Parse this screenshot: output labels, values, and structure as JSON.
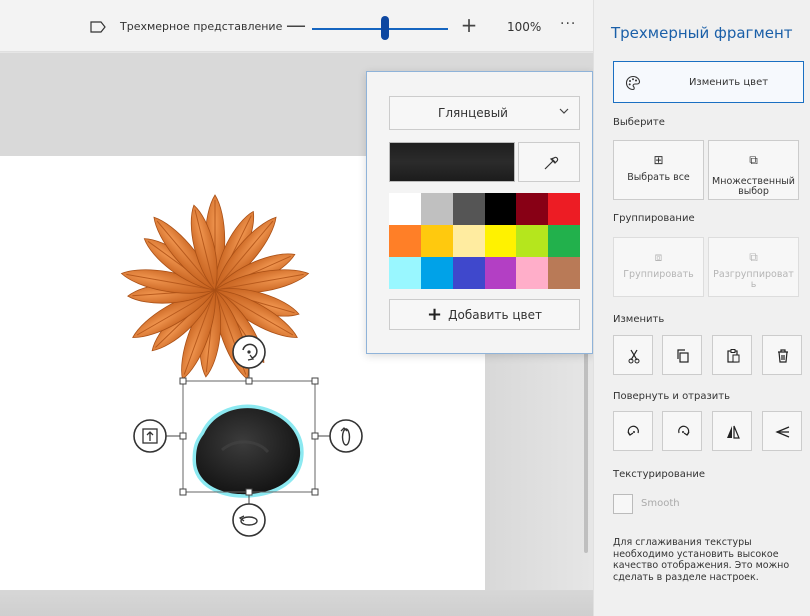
{
  "toolbar": {
    "view_icon": "view-3d-icon",
    "view_label": "Трехмерное представление",
    "zoom_minus": "—",
    "zoom_plus": "+",
    "zoom_level": "100%",
    "zoom_slider_value": 0.5,
    "more": "···"
  },
  "canvas": {
    "objects": [
      "flower-object",
      "stone-object"
    ],
    "gizmo_icons": [
      "rotate-z-icon",
      "rotate-y-icon",
      "move-depth-icon",
      "rotate-x-icon"
    ]
  },
  "color_popup": {
    "material": "Глянцевый",
    "current_color": "#222222",
    "eyedropper_icon": "eyedropper-icon",
    "swatches": [
      "#ffffff",
      "#c0c0c0",
      "#555555",
      "#000000",
      "#880015",
      "#ed1c24",
      "#ff7f27",
      "#ffc90e",
      "#ffeca0",
      "#fff200",
      "#b5e61d",
      "#22b14c",
      "#99f7ff",
      "#00a2e8",
      "#3f48cc",
      "#b33fc4",
      "#ffaec9",
      "#b97a57"
    ],
    "add_color": "Добавить цвет"
  },
  "panel": {
    "title": "Трехмерный фрагмент",
    "change_color": "Изменить цвет",
    "select_section": "Выберите",
    "select_all": "Выбрать все",
    "multi_select": "Множественный выбор",
    "group_section": "Группирование",
    "group": "Группировать",
    "ungroup": "Разгруппироват ь",
    "edit_section": "Изменить",
    "edit_tools": [
      "cut-icon",
      "copy-icon",
      "paste-icon",
      "delete-icon"
    ],
    "rotate_section": "Повернуть и отразить",
    "rotate_tools": [
      "rotate-left-icon",
      "rotate-right-icon",
      "flip-horizontal-icon",
      "flip-vertical-icon"
    ],
    "texture_section": "Текстурирование",
    "smooth_label": "Smooth",
    "smooth_checked": false,
    "help_text": "Для сглаживания текстуры необходимо установить высокое качество отображения. Это можно сделать в разделе настроек."
  },
  "colors": {
    "accent": "#1a6fc2",
    "slider": "#0d47a1",
    "flower": "#e07a35",
    "stone": "#2a2a2a",
    "stone_glow": "#7fe7ef"
  }
}
